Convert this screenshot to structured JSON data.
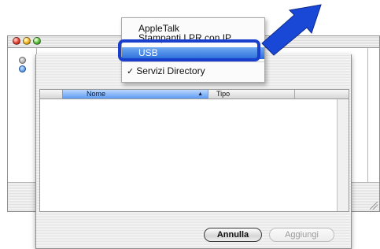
{
  "menu": {
    "items": [
      {
        "label": "AppleTalk"
      },
      {
        "label": "Stampanti LPR con IP"
      },
      {
        "label": "USB"
      },
      {
        "label": "Servizi Directory",
        "checked": true
      }
    ]
  },
  "list": {
    "columns": [
      {
        "label": "Nome",
        "sorted": "ascending"
      },
      {
        "label": "Tipo"
      }
    ],
    "rows": []
  },
  "buttons": {
    "cancel": "Annulla",
    "add": "Aggiungi"
  },
  "colors": {
    "selection": "#2c6edb",
    "highlight_ring": "#1a3fcc",
    "annotation_arrow": "#1a48d6"
  },
  "icons": {
    "check": "✓",
    "sort": "▲"
  }
}
